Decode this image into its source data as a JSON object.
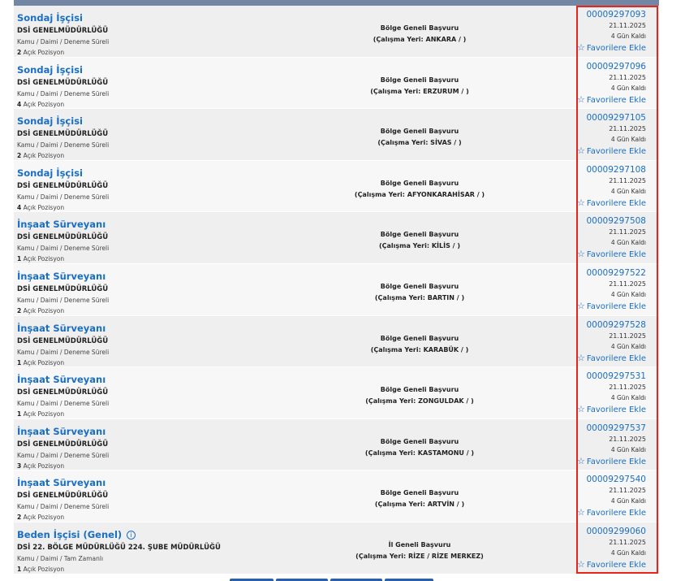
{
  "listings": [
    {
      "title": "Sondaj İşçisi",
      "org": "DSİ GENELMÜDÜRLÜĞÜ",
      "meta": "Kamu / Daimi / Deneme Süreli",
      "count": "2",
      "positions_label": "Açık Pozisyon",
      "scope": "Bölge Geneli Başvuru",
      "location": "(Çalışma Yeri: ANKARA / )",
      "ilan_no": "00009297093",
      "date": "21.11.2025",
      "remaining": "4 Gün Kaldı",
      "fav": "Favorilere Ekle",
      "info": false
    },
    {
      "title": "Sondaj İşçisi",
      "org": "DSİ GENELMÜDÜRLÜĞÜ",
      "meta": "Kamu / Daimi / Deneme Süreli",
      "count": "4",
      "positions_label": "Açık Pozisyon",
      "scope": "Bölge Geneli Başvuru",
      "location": "(Çalışma Yeri: ERZURUM / )",
      "ilan_no": "00009297096",
      "date": "21.11.2025",
      "remaining": "4 Gün Kaldı",
      "fav": "Favorilere Ekle",
      "info": false
    },
    {
      "title": "Sondaj İşçisi",
      "org": "DSİ GENELMÜDÜRLÜĞÜ",
      "meta": "Kamu / Daimi / Deneme Süreli",
      "count": "2",
      "positions_label": "Açık Pozisyon",
      "scope": "Bölge Geneli Başvuru",
      "location": "(Çalışma Yeri: SİVAS / )",
      "ilan_no": "00009297105",
      "date": "21.11.2025",
      "remaining": "4 Gün Kaldı",
      "fav": "Favorilere Ekle",
      "info": false
    },
    {
      "title": "Sondaj İşçisi",
      "org": "DSİ GENELMÜDÜRLÜĞÜ",
      "meta": "Kamu / Daimi / Deneme Süreli",
      "count": "4",
      "positions_label": "Açık Pozisyon",
      "scope": "Bölge Geneli Başvuru",
      "location": "(Çalışma Yeri: AFYONKARAHİSAR / )",
      "ilan_no": "00009297108",
      "date": "21.11.2025",
      "remaining": "4 Gün Kaldı",
      "fav": "Favorilere Ekle",
      "info": false
    },
    {
      "title": "İnşaat Sürveyanı",
      "org": "DSİ GENELMÜDÜRLÜĞÜ",
      "meta": "Kamu / Daimi / Deneme Süreli",
      "count": "1",
      "positions_label": "Açık Pozisyon",
      "scope": "Bölge Geneli Başvuru",
      "location": "(Çalışma Yeri: KİLİS / )",
      "ilan_no": "00009297508",
      "date": "21.11.2025",
      "remaining": "4 Gün Kaldı",
      "fav": "Favorilere Ekle",
      "info": false
    },
    {
      "title": "İnşaat Sürveyanı",
      "org": "DSİ GENELMÜDÜRLÜĞÜ",
      "meta": "Kamu / Daimi / Deneme Süreli",
      "count": "2",
      "positions_label": "Açık Pozisyon",
      "scope": "Bölge Geneli Başvuru",
      "location": "(Çalışma Yeri: BARTIN / )",
      "ilan_no": "00009297522",
      "date": "21.11.2025",
      "remaining": "4 Gün Kaldı",
      "fav": "Favorilere Ekle",
      "info": false
    },
    {
      "title": "İnşaat Sürveyanı",
      "org": "DSİ GENELMÜDÜRLÜĞÜ",
      "meta": "Kamu / Daimi / Deneme Süreli",
      "count": "1",
      "positions_label": "Açık Pozisyon",
      "scope": "Bölge Geneli Başvuru",
      "location": "(Çalışma Yeri: KARABÜK / )",
      "ilan_no": "00009297528",
      "date": "21.11.2025",
      "remaining": "4 Gün Kaldı",
      "fav": "Favorilere Ekle",
      "info": false
    },
    {
      "title": "İnşaat Sürveyanı",
      "org": "DSİ GENELMÜDÜRLÜĞÜ",
      "meta": "Kamu / Daimi / Deneme Süreli",
      "count": "1",
      "positions_label": "Açık Pozisyon",
      "scope": "Bölge Geneli Başvuru",
      "location": "(Çalışma Yeri: ZONGULDAK / )",
      "ilan_no": "00009297531",
      "date": "21.11.2025",
      "remaining": "4 Gün Kaldı",
      "fav": "Favorilere Ekle",
      "info": false
    },
    {
      "title": "İnşaat Sürveyanı",
      "org": "DSİ GENELMÜDÜRLÜĞÜ",
      "meta": "Kamu / Daimi / Deneme Süreli",
      "count": "3",
      "positions_label": "Açık Pozisyon",
      "scope": "Bölge Geneli Başvuru",
      "location": "(Çalışma Yeri: KASTAMONU / )",
      "ilan_no": "00009297537",
      "date": "21.11.2025",
      "remaining": "4 Gün Kaldı",
      "fav": "Favorilere Ekle",
      "info": false
    },
    {
      "title": "İnşaat Sürveyanı",
      "org": "DSİ GENELMÜDÜRLÜĞÜ",
      "meta": "Kamu / Daimi / Deneme Süreli",
      "count": "2",
      "positions_label": "Açık Pozisyon",
      "scope": "Bölge Geneli Başvuru",
      "location": "(Çalışma Yeri: ARTVİN / )",
      "ilan_no": "00009297540",
      "date": "21.11.2025",
      "remaining": "4 Gün Kaldı",
      "fav": "Favorilere Ekle",
      "info": false
    },
    {
      "title": "Beden İşçisi (Genel)",
      "org": "DSİ 22. BÖLGE MÜDÜRLÜĞÜ 224. ŞUBE MÜDÜRLÜĞÜ",
      "meta": "Kamu / Daimi / Tam Zamanlı",
      "count": "1",
      "positions_label": "Açık Pozisyon",
      "scope": "İl Geneli Başvuru",
      "location": "(Çalışma Yeri: RİZE / RİZE MERKEZ)",
      "ilan_no": "00009299060",
      "date": "21.11.2025",
      "remaining": "4 Gün Kaldı",
      "fav": "Favorilere Ekle",
      "info": true
    }
  ],
  "icons": {
    "favorite": "star-outline-icon",
    "info": "info-circle-icon"
  },
  "colors": {
    "link": "#1a6fc2",
    "highlight": "#e8251b",
    "header_bar": "#7386a3"
  }
}
